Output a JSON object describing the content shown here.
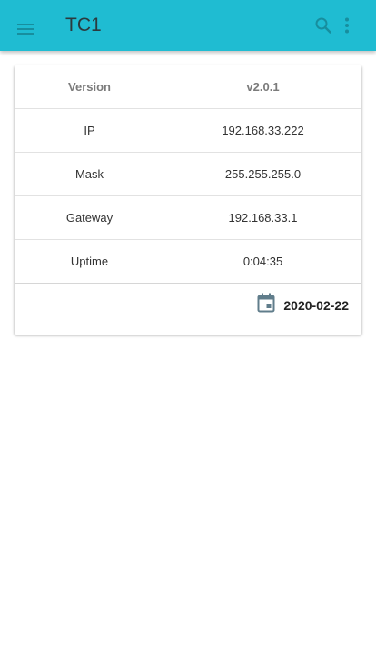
{
  "appbar": {
    "title": "TC1",
    "menu_icon": "hamburger-menu-icon",
    "search_icon": "search-icon",
    "more_icon": "more-vertical-icon",
    "background": "#1fbcd2"
  },
  "info_table": {
    "headers": [
      "Version",
      "v2.0.1"
    ],
    "rows": [
      {
        "key": "IP",
        "value": "192.168.33.222"
      },
      {
        "key": "Mask",
        "value": "255.255.255.0"
      },
      {
        "key": "Gateway",
        "value": "192.168.33.1"
      },
      {
        "key": "Uptime",
        "value": "0:04:35"
      }
    ]
  },
  "footer": {
    "date_icon": "calendar-icon",
    "date": "2020-02-22"
  }
}
